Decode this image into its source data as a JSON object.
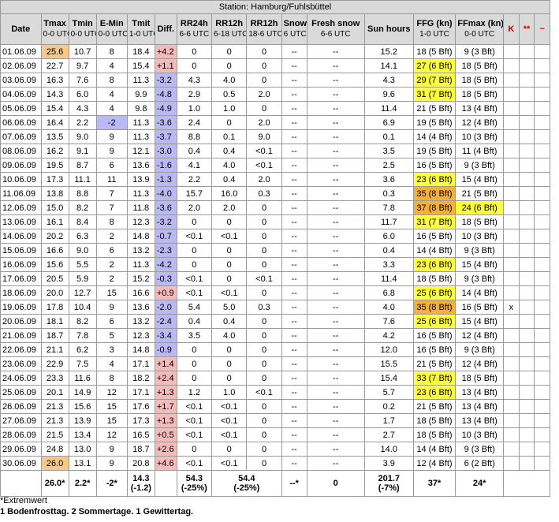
{
  "station": "Station: Hamburg/Fuhlsbüttel",
  "headers": [
    {
      "label": "Date",
      "sub": ""
    },
    {
      "label": "Tmax",
      "sub": "0-0 UTC"
    },
    {
      "label": "Tmin",
      "sub": "0-0 UTC"
    },
    {
      "label": "E-Min",
      "sub": "0-0 UTC"
    },
    {
      "label": "Tmit",
      "sub": "1-0 UTC"
    },
    {
      "label": "Diff.",
      "sub": ""
    },
    {
      "label": "RR24h",
      "sub": "6-6 UTC"
    },
    {
      "label": "RR12h",
      "sub": "6-18 UTC"
    },
    {
      "label": "RR12h",
      "sub": "18-6 UTC"
    },
    {
      "label": "Snow",
      "sub": "6 UTC"
    },
    {
      "label": "Fresh snow",
      "sub": "6-6 UTC"
    },
    {
      "label": "Sun hours",
      "sub": ""
    },
    {
      "label": "FFG (kn)",
      "sub": "1-0 UTC"
    },
    {
      "label": "FFmax (kn)",
      "sub": "0-0 UTC"
    },
    {
      "label": "K",
      "sub": ""
    },
    {
      "label": "**",
      "sub": ""
    },
    {
      "label": "~",
      "sub": ""
    }
  ],
  "rows": [
    [
      "01.06.09",
      "25.6",
      "10.7",
      "8",
      "18.4",
      "+4.2",
      "0",
      "0",
      "0",
      "--",
      "--",
      "15.2",
      "18 (5 Bft)",
      "9 (3 Bft)",
      "",
      "",
      ""
    ],
    [
      "02.06.09",
      "22.7",
      "9.7",
      "4",
      "15.4",
      "+1.1",
      "0",
      "0",
      "0",
      "--",
      "--",
      "14.1",
      "27 (6 Bft)",
      "18 (5 Bft)",
      "",
      "",
      ""
    ],
    [
      "03.06.09",
      "16.3",
      "7.6",
      "8",
      "11.3",
      "-3.2",
      "4.3",
      "4.0",
      "0",
      "--",
      "--",
      "4.3",
      "29 (7 Bft)",
      "18 (5 Bft)",
      "",
      "",
      ""
    ],
    [
      "04.06.09",
      "14.3",
      "6.0",
      "4",
      "9.9",
      "-4.8",
      "2.9",
      "0.5",
      "2.0",
      "--",
      "--",
      "9.6",
      "31 (7 Bft)",
      "18 (5 Bft)",
      "",
      "",
      ""
    ],
    [
      "05.06.09",
      "15.4",
      "4.3",
      "4",
      "9.8",
      "-4.9",
      "1.0",
      "1.0",
      "0",
      "--",
      "--",
      "11.4",
      "21 (5 Bft)",
      "13 (4 Bft)",
      "",
      "",
      ""
    ],
    [
      "06.06.09",
      "16.4",
      "2.2",
      "-2",
      "11.3",
      "-3.6",
      "2.4",
      "0",
      "2.0",
      "--",
      "--",
      "6.9",
      "19 (5 Bft)",
      "12 (4 Bft)",
      "",
      "",
      ""
    ],
    [
      "07.06.09",
      "13.5",
      "9.0",
      "9",
      "11.3",
      "-3.7",
      "8.8",
      "0.1",
      "9.0",
      "--",
      "--",
      "0.1",
      "14 (4 Bft)",
      "10 (3 Bft)",
      "",
      "",
      ""
    ],
    [
      "08.06.09",
      "16.2",
      "9.1",
      "9",
      "12.1",
      "-3.0",
      "0.4",
      "0.4",
      "<0.1",
      "--",
      "--",
      "3.5",
      "19 (5 Bft)",
      "11 (4 Bft)",
      "",
      "",
      ""
    ],
    [
      "09.06.09",
      "19.5",
      "8.7",
      "6",
      "13.6",
      "-1.6",
      "4.1",
      "4.0",
      "<0.1",
      "--",
      "--",
      "2.5",
      "16 (5 Bft)",
      "9 (3 Bft)",
      "",
      "",
      ""
    ],
    [
      "10.06.09",
      "17.3",
      "11.1",
      "11",
      "13.9",
      "-1.3",
      "2.2",
      "0.4",
      "2.0",
      "--",
      "--",
      "3.6",
      "23 (6 Bft)",
      "15 (4 Bft)",
      "",
      "",
      ""
    ],
    [
      "11.06.09",
      "13.8",
      "8.8",
      "7",
      "11.3",
      "-4.0",
      "15.7",
      "16.0",
      "0.3",
      "--",
      "--",
      "0.3",
      "35 (8 Bft)",
      "21 (5 Bft)",
      "",
      "",
      ""
    ],
    [
      "12.06.09",
      "15.0",
      "8.2",
      "7",
      "11.8",
      "-3.6",
      "2.0",
      "2.0",
      "0",
      "--",
      "--",
      "7.8",
      "37 (8 Bft)",
      "24 (6 Bft)",
      "",
      "",
      ""
    ],
    [
      "13.06.09",
      "16.1",
      "8.4",
      "8",
      "12.3",
      "-3.2",
      "0",
      "0",
      "0",
      "--",
      "--",
      "11.7",
      "31 (7 Bft)",
      "18 (5 Bft)",
      "",
      "",
      ""
    ],
    [
      "14.06.09",
      "20.2",
      "6.3",
      "2",
      "14.8",
      "-0.7",
      "<0.1",
      "<0.1",
      "0",
      "--",
      "--",
      "6.0",
      "16 (5 Bft)",
      "10 (3 Bft)",
      "",
      "",
      ""
    ],
    [
      "15.06.09",
      "16.6",
      "9.0",
      "6",
      "13.2",
      "-2.3",
      "0",
      "0",
      "0",
      "--",
      "--",
      "0.4",
      "14 (4 Bft)",
      "9 (3 Bft)",
      "",
      "",
      ""
    ],
    [
      "16.06.09",
      "15.6",
      "5.5",
      "2",
      "11.3",
      "-4.2",
      "0",
      "0",
      "0",
      "--",
      "--",
      "3.3",
      "23 (6 Bft)",
      "15 (4 Bft)",
      "",
      "",
      ""
    ],
    [
      "17.06.09",
      "20.5",
      "5.9",
      "2",
      "15.2",
      "-0.3",
      "<0.1",
      "0",
      "<0.1",
      "--",
      "--",
      "11.4",
      "18 (5 Bft)",
      "9 (3 Bft)",
      "",
      "",
      ""
    ],
    [
      "18.06.09",
      "20.0",
      "12.7",
      "15",
      "16.6",
      "+0.9",
      "<0.1",
      "<0.1",
      "0",
      "--",
      "--",
      "6.8",
      "25 (6 Bft)",
      "14 (4 Bft)",
      "",
      "",
      ""
    ],
    [
      "19.06.09",
      "17.8",
      "10.4",
      "9",
      "13.6",
      "-2.0",
      "5.4",
      "5.0",
      "0.3",
      "--",
      "--",
      "4.0",
      "35 (8 Bft)",
      "16 (5 Bft)",
      "x",
      "",
      ""
    ],
    [
      "20.06.09",
      "18.1",
      "8.2",
      "6",
      "13.2",
      "-2.4",
      "0.4",
      "0.4",
      "0",
      "--",
      "--",
      "7.6",
      "25 (6 Bft)",
      "15 (4 Bft)",
      "",
      "",
      ""
    ],
    [
      "21.06.09",
      "18.7",
      "7.8",
      "5",
      "12.3",
      "-3.4",
      "3.5",
      "4.0",
      "0",
      "--",
      "--",
      "4.2",
      "16 (5 Bft)",
      "12 (4 Bft)",
      "",
      "",
      ""
    ],
    [
      "22.06.09",
      "21.1",
      "6.2",
      "3",
      "14.8",
      "-0.9",
      "0",
      "0",
      "0",
      "--",
      "--",
      "12.0",
      "16 (5 Bft)",
      "9 (3 Bft)",
      "",
      "",
      ""
    ],
    [
      "23.06.09",
      "22.9",
      "7.5",
      "4",
      "17.1",
      "+1.4",
      "0",
      "0",
      "0",
      "--",
      "--",
      "15.5",
      "21 (5 Bft)",
      "12 (4 Bft)",
      "",
      "",
      ""
    ],
    [
      "24.06.09",
      "23.3",
      "11.6",
      "8",
      "18.2",
      "+2.4",
      "0",
      "0",
      "0",
      "--",
      "--",
      "15.4",
      "33 (7 Bft)",
      "18 (5 Bft)",
      "",
      "",
      ""
    ],
    [
      "25.06.09",
      "20.1",
      "14.9",
      "12",
      "17.1",
      "+1.3",
      "1.2",
      "1.0",
      "<0.1",
      "--",
      "--",
      "5.7",
      "23 (6 Bft)",
      "13 (4 Bft)",
      "",
      "",
      ""
    ],
    [
      "26.06.09",
      "21.3",
      "15.6",
      "15",
      "17.6",
      "+1.7",
      "<0.1",
      "<0.1",
      "0",
      "--",
      "--",
      "0.2",
      "21 (5 Bft)",
      "13 (4 Bft)",
      "",
      "",
      ""
    ],
    [
      "27.06.09",
      "21.3",
      "13.9",
      "15",
      "17.3",
      "+1.3",
      "<0.1",
      "<0.1",
      "0",
      "--",
      "--",
      "1.7",
      "18 (5 Bft)",
      "13 (4 Bft)",
      "",
      "",
      ""
    ],
    [
      "28.06.09",
      "21.5",
      "13.4",
      "12",
      "16.5",
      "+0.5",
      "<0.1",
      "<0.1",
      "0",
      "--",
      "--",
      "2.7",
      "18 (5 Bft)",
      "10 (3 Bft)",
      "",
      "",
      ""
    ],
    [
      "29.06.09",
      "24.8",
      "13.0",
      "9",
      "18.7",
      "+2.6",
      "0",
      "0",
      "0",
      "--",
      "--",
      "14.0",
      "14 (4 Bft)",
      "9 (3 Bft)",
      "",
      "",
      ""
    ],
    [
      "30.06.09",
      "26.0",
      "13.1",
      "9",
      "20.8",
      "+4.6",
      "<0.1",
      "<0.1",
      "0",
      "--",
      "--",
      "3.9",
      "12 (4 Bft)",
      "6 (2 Bft)",
      "",
      "",
      ""
    ]
  ],
  "summary": {
    "tmax": "26.0*",
    "tmin": "2.2*",
    "emin": "-2*",
    "tmit": "14.3",
    "tmit2": "(-1.2)",
    "rr24": "54.3",
    "rr24b": "(-25%)",
    "rr12": "54.4",
    "rr12b": "(-25%)",
    "snow": "--*",
    "fresh": "0",
    "sun": "201.7",
    "sunb": "(-7%)",
    "ffg": "37*",
    "ffmax": "24*"
  },
  "notes": {
    "line1": "*Extremwert",
    "line2": "1 Bodenfrosttag. 2 Sommertage. 1 Gewittertag."
  },
  "colors": {
    "header_bg": "#dadada",
    "positive_diff": "#f7b9b9",
    "negative_diff": "#b9b9f7",
    "highlight_yellow": "#ffff3a",
    "highlight_orange": "#f6b03a",
    "warm_tmax": "#f6c98a"
  }
}
